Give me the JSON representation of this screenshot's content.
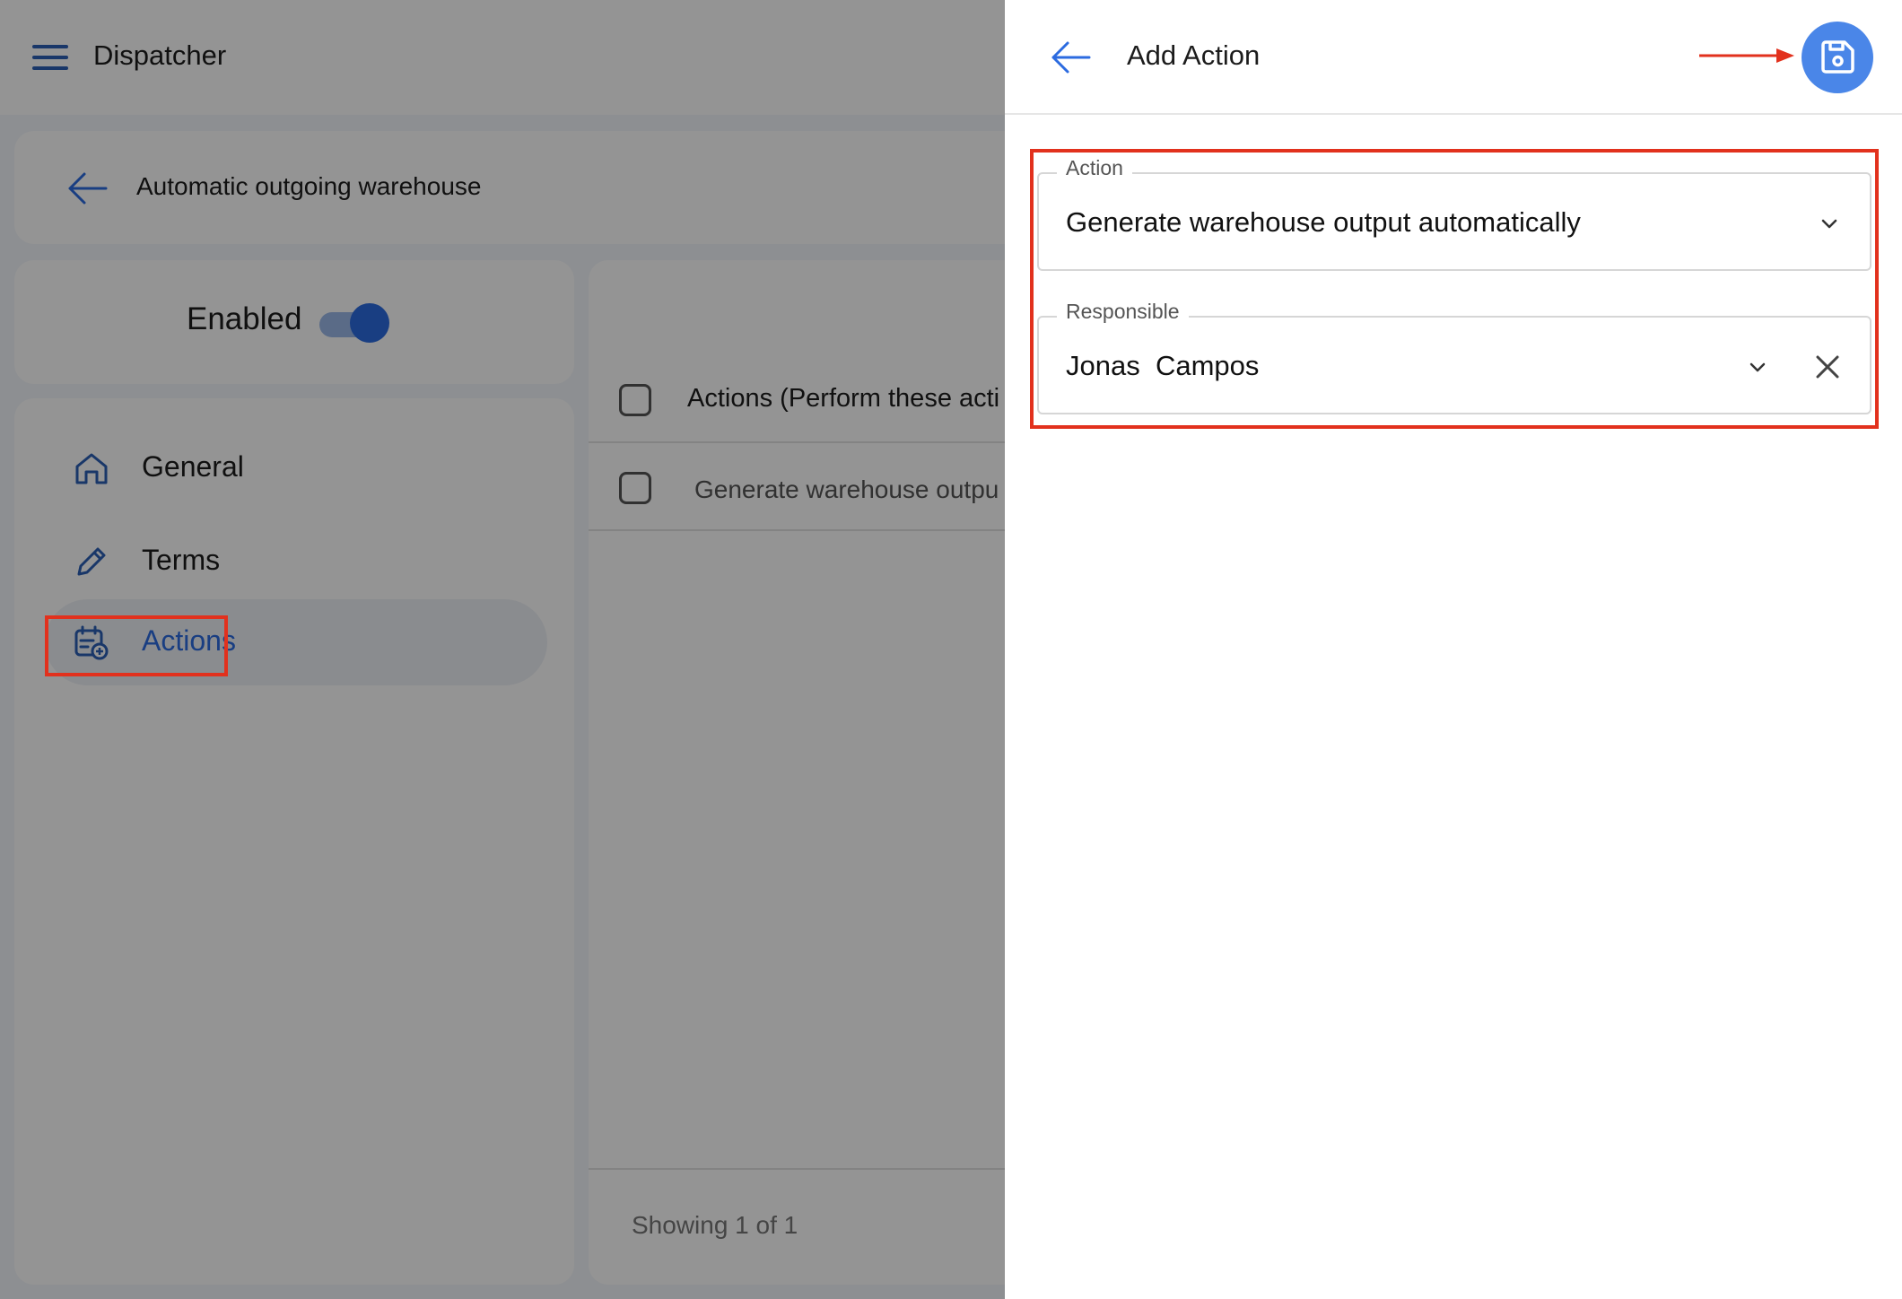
{
  "app": {
    "title": "Dispatcher"
  },
  "breadcrumb": {
    "title": "Automatic outgoing warehouse"
  },
  "status": {
    "label": "Enabled",
    "enabled": true
  },
  "sidebar": {
    "items": [
      {
        "label": "General",
        "icon": "home-icon"
      },
      {
        "label": "Terms",
        "icon": "pencil-icon"
      },
      {
        "label": "Actions",
        "icon": "calendar-add-icon",
        "active": true
      }
    ]
  },
  "list": {
    "header": "Actions (Perform these acti",
    "rows": [
      "Generate warehouse outpu"
    ],
    "footer": "Showing 1 of 1"
  },
  "panel": {
    "title": "Add Action",
    "fields": {
      "action": {
        "label": "Action",
        "value": "Generate warehouse output automatically"
      },
      "responsible": {
        "label": "Responsible",
        "value": "Jonas  Campos"
      }
    }
  },
  "colors": {
    "accent": "#2c6be0",
    "save_button": "#4a86e8",
    "annotation": "#e2311d"
  }
}
